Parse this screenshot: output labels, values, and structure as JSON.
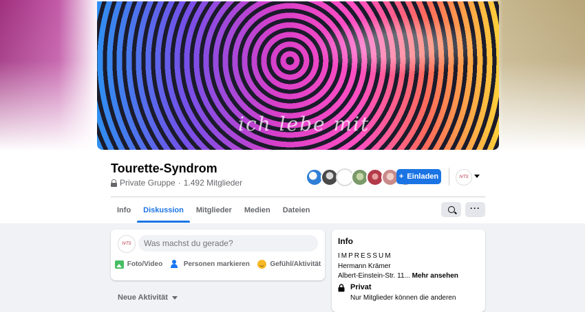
{
  "cover": {
    "overlay_text": "ich lebe mit",
    "colors": {
      "left_glow": "#c25aa8",
      "right_glow": "#b9a67a"
    }
  },
  "group": {
    "title": "Tourette-Syndrom",
    "privacy": "Private Gruppe",
    "separator": "·",
    "members": "1.492 Mitglieder"
  },
  "header_actions": {
    "invite_label": "Einladen",
    "invite_icon": "plus-icon",
    "page_avatar_text": "IVTS",
    "member_avatars": [
      {
        "name": "member-avatar-1",
        "color": "#2f7fd6"
      },
      {
        "name": "member-avatar-2",
        "color": "#4a4a4a"
      },
      {
        "name": "member-avatar-3",
        "color": "#ffffff"
      },
      {
        "name": "member-avatar-4",
        "color": "#7a9a6a"
      },
      {
        "name": "member-avatar-5",
        "color": "#b23a4a"
      },
      {
        "name": "member-avatar-6",
        "color": "#c98a8a"
      },
      {
        "name": "member-avatar-7",
        "color": "#9a9a9a"
      }
    ]
  },
  "tabs": [
    {
      "label": "Info",
      "active": false
    },
    {
      "label": "Diskussion",
      "active": true
    },
    {
      "label": "Mitglieder",
      "active": false
    },
    {
      "label": "Medien",
      "active": false
    },
    {
      "label": "Dateien",
      "active": false
    }
  ],
  "toolbar": {
    "search_icon": "search-icon",
    "more_icon": "more-icon",
    "more_glyph": "···"
  },
  "composer": {
    "avatar_text": "IVTS",
    "placeholder": "Was machst du gerade?",
    "actions": [
      {
        "label": "Foto/Video",
        "icon": "photo-icon",
        "color": "#45bd62"
      },
      {
        "label": "Personen markieren",
        "icon": "tag-people-icon",
        "color": "#1877f2"
      },
      {
        "label": "Gefühl/Aktivität",
        "icon": "feeling-icon",
        "color": "#f7b928"
      }
    ]
  },
  "feed": {
    "sort_label": "Neue Aktivität"
  },
  "info": {
    "title": "Info",
    "impressum": "IMPRESSUM",
    "name": "Hermann Krämer",
    "address": "Albert-Einstein-Str. 11...",
    "more": "Mehr ansehen",
    "privacy_title": "Privat",
    "privacy_desc": "Nur Mitglieder können die anderen"
  }
}
